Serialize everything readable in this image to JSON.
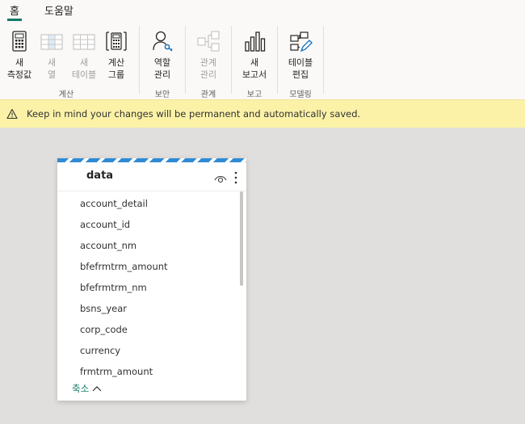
{
  "tabs": [
    {
      "label": "홈",
      "active": true
    },
    {
      "label": "도움말",
      "active": false
    }
  ],
  "ribbon": {
    "groups": [
      {
        "label": "계산",
        "buttons": [
          {
            "line1": "새",
            "line2": "측정값",
            "icon": "calculator-icon",
            "enabled": true
          },
          {
            "line1": "새",
            "line2": "열",
            "icon": "column-table-icon",
            "enabled": false
          },
          {
            "line1": "새",
            "line2": "테이블",
            "icon": "table-icon",
            "enabled": false
          },
          {
            "line1": "계산",
            "line2": "그룹",
            "icon": "calc-group-icon",
            "enabled": true
          }
        ]
      },
      {
        "label": "보안",
        "buttons": [
          {
            "line1": "역할",
            "line2": "관리",
            "icon": "manage-roles-icon",
            "enabled": true
          }
        ]
      },
      {
        "label": "관계",
        "buttons": [
          {
            "line1": "관계",
            "line2": "관리",
            "icon": "relationships-icon",
            "enabled": false
          }
        ]
      },
      {
        "label": "보고",
        "buttons": [
          {
            "line1": "새",
            "line2": "보고서",
            "icon": "bar-chart-icon",
            "enabled": true
          }
        ]
      },
      {
        "label": "모델링",
        "buttons": [
          {
            "line1": "테이블",
            "line2": "편집",
            "icon": "edit-tables-icon",
            "enabled": true
          }
        ]
      }
    ]
  },
  "infobar": {
    "icon": "warning-icon",
    "message": "Keep in mind your changes will be permanent and automatically saved."
  },
  "card": {
    "title": "data",
    "fields": [
      "account_detail",
      "account_id",
      "account_nm",
      "bfefrmtrm_amount",
      "bfefrmtrm_nm",
      "bsns_year",
      "corp_code",
      "currency",
      "frmtrm_amount"
    ],
    "collapse_label": "축소"
  },
  "colors": {
    "accent": "#117865",
    "stripe": "#2e8bd6",
    "infobar_bg": "#fbf2a8",
    "canvas_bg": "#e1dfdd"
  }
}
